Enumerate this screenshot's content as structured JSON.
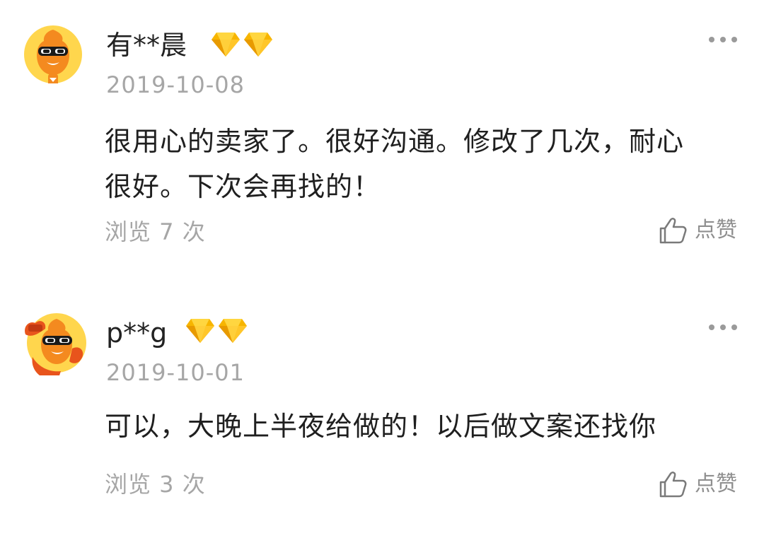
{
  "reviews": [
    {
      "username": "有**晨",
      "date": "2019-10-08",
      "content_line1": "很用心的卖家了。很好沟通。修改了几次，耐心",
      "content_line2": "很好。下次会再找的！",
      "views": "浏览 7 次",
      "like_label": "点赞",
      "badges": 2
    },
    {
      "username": "p**g",
      "date": "2019-10-01",
      "content_line1": "可以，大晚上半夜给做的！以后做文案还找你",
      "content_line2": "",
      "views": "浏览 3 次",
      "like_label": "点赞",
      "badges": 2
    }
  ],
  "icons": {
    "more": "more-dots-icon",
    "like": "thumbs-up-icon",
    "badge": "diamond-icon",
    "avatar": "mascot-avatar"
  },
  "colors": {
    "avatar_orange": "#f48a1f",
    "avatar_bg": "#ffd64d",
    "diamond_gold": "#f7b500",
    "muted_text": "#a6a6a6"
  }
}
